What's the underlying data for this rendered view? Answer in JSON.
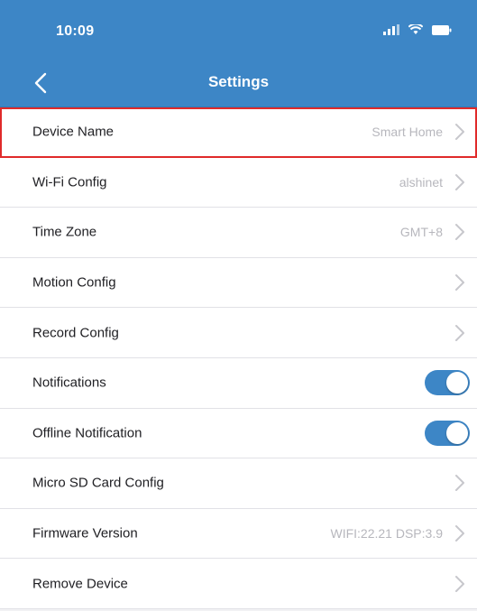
{
  "status_bar": {
    "time": "10:09",
    "icons": [
      "signal-icon",
      "wifi-icon",
      "battery-icon"
    ]
  },
  "nav": {
    "title": "Settings",
    "back_icon": "chevron-left-icon"
  },
  "colors": {
    "accent": "#3d86c6",
    "highlight_border": "#e02a2a"
  },
  "rows": [
    {
      "label": "Device Name",
      "value": "Smart Home",
      "control": "chevron",
      "highlighted": true
    },
    {
      "label": "Wi-Fi Config",
      "value": "alshinet",
      "control": "chevron"
    },
    {
      "label": "Time Zone",
      "value": "GMT+8",
      "control": "chevron"
    },
    {
      "label": "Motion Config",
      "value": "",
      "control": "chevron"
    },
    {
      "label": "Record Config",
      "value": "",
      "control": "chevron"
    },
    {
      "label": "Notifications",
      "value": "",
      "control": "toggle",
      "on": true
    },
    {
      "label": "Offline Notification",
      "value": "",
      "control": "toggle",
      "on": true
    },
    {
      "label": "Micro SD Card Config",
      "value": "",
      "control": "chevron"
    },
    {
      "label": "Firmware Version",
      "value": "WIFI:22.21 DSP:3.9",
      "control": "chevron"
    },
    {
      "label": "Remove Device",
      "value": "",
      "control": "chevron"
    }
  ]
}
